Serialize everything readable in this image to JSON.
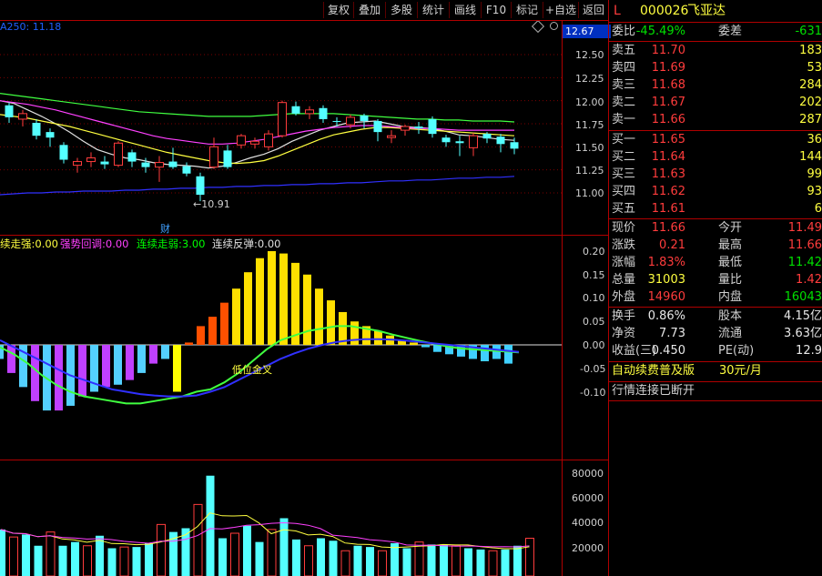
{
  "toolbar": {
    "buttons": [
      "复权",
      "叠加",
      "多股",
      "统计",
      "画线",
      "F10",
      "标记",
      "+自选",
      "返回"
    ]
  },
  "header": {
    "marker": "L",
    "code": "000026",
    "name": "飞亚达"
  },
  "chart_top_label": "A250: 11.18",
  "price_axis": {
    "current": "12.67",
    "ticks": [
      "12.50",
      "12.25",
      "12.00",
      "11.75",
      "11.50",
      "11.25",
      "11.00"
    ],
    "low_annotation": "10.91",
    "finance_mark": "财"
  },
  "indicator_legend": {
    "items": [
      {
        "label": "续走强:",
        "value": "0.00",
        "color": "#ffff40"
      },
      {
        "label": "强势回调:",
        "value": "0.00",
        "color": "#ff40ff"
      },
      {
        "label": "连续走弱:",
        "value": "3.00",
        "color": "#00ff00"
      },
      {
        "label": "连续反弹:",
        "value": "0.00",
        "color": "#e0e0e0"
      }
    ],
    "annotation": "低位金叉"
  },
  "indicator_axis": {
    "ticks": [
      "0.20",
      "0.15",
      "0.10",
      "0.05",
      "0.00",
      "-0.05",
      "-0.10"
    ]
  },
  "volume_axis": {
    "ticks": [
      "80000",
      "60000",
      "40000",
      "20000"
    ]
  },
  "quote": {
    "weibi": {
      "label": "委比",
      "value": "-45.49%",
      "label2": "委差",
      "value2": "-631"
    },
    "asks": [
      {
        "label": "卖五",
        "price": "11.70",
        "vol": "183"
      },
      {
        "label": "卖四",
        "price": "11.69",
        "vol": "53"
      },
      {
        "label": "卖三",
        "price": "11.68",
        "vol": "284"
      },
      {
        "label": "卖二",
        "price": "11.67",
        "vol": "202"
      },
      {
        "label": "卖一",
        "price": "11.66",
        "vol": "287"
      }
    ],
    "bids": [
      {
        "label": "买一",
        "price": "11.65",
        "vol": "36"
      },
      {
        "label": "买二",
        "price": "11.64",
        "vol": "144"
      },
      {
        "label": "买三",
        "price": "11.63",
        "vol": "99"
      },
      {
        "label": "买四",
        "price": "11.62",
        "vol": "93"
      },
      {
        "label": "买五",
        "price": "11.61",
        "vol": "6"
      }
    ],
    "stats1": [
      {
        "l": "现价",
        "v": "11.66",
        "vc": "red",
        "l2": "今开",
        "v2": "11.49",
        "v2c": "red"
      },
      {
        "l": "涨跌",
        "v": "0.21",
        "vc": "red",
        "l2": "最高",
        "v2": "11.66",
        "v2c": "red"
      },
      {
        "l": "涨幅",
        "v": "1.83%",
        "vc": "red",
        "l2": "最低",
        "v2": "11.42",
        "v2c": "green"
      },
      {
        "l": "总量",
        "v": "31003",
        "vc": "yellow",
        "l2": "量比",
        "v2": "1.42",
        "v2c": "red"
      },
      {
        "l": "外盘",
        "v": "14960",
        "vc": "red",
        "l2": "内盘",
        "v2": "16043",
        "v2c": "green"
      }
    ],
    "stats2": [
      {
        "l": "换手",
        "v": "0.86%",
        "l2": "股本",
        "v2": "4.15亿"
      },
      {
        "l": "净资",
        "v": "7.73",
        "l2": "流通",
        "v2": "3.63亿"
      },
      {
        "l": "收益(三)",
        "v": "0.450",
        "l2": "PE(动)",
        "v2": "12.9"
      }
    ],
    "promo": "自动续费普及版",
    "promo_price": "30元/月",
    "status": "行情连接已断开"
  },
  "colors": {
    "up": "#ff3c3c",
    "down": "#54ffff",
    "ma_white": "#e0e0e0",
    "ma_yellow": "#ffff40",
    "ma_magenta": "#ff40ff",
    "ma_green": "#40ff40",
    "ma_blue": "#3030ff"
  },
  "candles": [
    {
      "o": 11.95,
      "c": 11.82,
      "h": 11.98,
      "l": 11.76
    },
    {
      "o": 11.8,
      "c": 11.86,
      "h": 11.9,
      "l": 11.72
    },
    {
      "o": 11.76,
      "c": 11.62,
      "h": 11.8,
      "l": 11.58
    },
    {
      "o": 11.66,
      "c": 11.6,
      "h": 11.7,
      "l": 11.5
    },
    {
      "o": 11.52,
      "c": 11.36,
      "h": 11.55,
      "l": 11.32
    },
    {
      "o": 11.3,
      "c": 11.34,
      "h": 11.38,
      "l": 11.22
    },
    {
      "o": 11.34,
      "c": 11.38,
      "h": 11.44,
      "l": 11.28
    },
    {
      "o": 11.34,
      "c": 11.31,
      "h": 11.4,
      "l": 11.26
    },
    {
      "o": 11.3,
      "c": 11.54,
      "h": 11.56,
      "l": 11.28
    },
    {
      "o": 11.44,
      "c": 11.34,
      "h": 11.47,
      "l": 11.28
    },
    {
      "o": 11.33,
      "c": 11.28,
      "h": 11.38,
      "l": 11.22
    },
    {
      "o": 11.28,
      "c": 11.33,
      "h": 11.4,
      "l": 11.12
    },
    {
      "o": 11.34,
      "c": 11.28,
      "h": 11.49,
      "l": 11.26
    },
    {
      "o": 11.29,
      "c": 11.21,
      "h": 11.33,
      "l": 11.18
    },
    {
      "o": 11.18,
      "c": 10.98,
      "h": 11.22,
      "l": 10.91
    },
    {
      "o": 11.28,
      "c": 11.5,
      "h": 11.6,
      "l": 11.26
    },
    {
      "o": 11.46,
      "c": 11.28,
      "h": 11.52,
      "l": 11.26
    },
    {
      "o": 11.52,
      "c": 11.62,
      "h": 11.64,
      "l": 11.48
    },
    {
      "o": 11.53,
      "c": 11.56,
      "h": 11.6,
      "l": 11.48
    },
    {
      "o": 11.5,
      "c": 11.64,
      "h": 11.68,
      "l": 11.46
    },
    {
      "o": 11.62,
      "c": 11.98,
      "h": 12.0,
      "l": 11.6
    },
    {
      "o": 11.94,
      "c": 11.86,
      "h": 11.99,
      "l": 11.84
    },
    {
      "o": 11.86,
      "c": 11.9,
      "h": 11.94,
      "l": 11.8
    },
    {
      "o": 11.92,
      "c": 11.8,
      "h": 11.95,
      "l": 11.76
    },
    {
      "o": 11.78,
      "c": 11.77,
      "h": 11.82,
      "l": 11.72
    },
    {
      "o": 11.74,
      "c": 11.82,
      "h": 11.85,
      "l": 11.7
    },
    {
      "o": 11.84,
      "c": 11.78,
      "h": 11.86,
      "l": 11.7
    },
    {
      "o": 11.78,
      "c": 11.66,
      "h": 11.8,
      "l": 11.56
    },
    {
      "o": 11.6,
      "c": 11.62,
      "h": 11.68,
      "l": 11.54
    },
    {
      "o": 11.68,
      "c": 11.72,
      "h": 11.74,
      "l": 11.62
    },
    {
      "o": 11.72,
      "c": 11.7,
      "h": 11.77,
      "l": 11.64
    },
    {
      "o": 11.8,
      "c": 11.64,
      "h": 11.83,
      "l": 11.6
    },
    {
      "o": 11.6,
      "c": 11.55,
      "h": 11.63,
      "l": 11.5
    },
    {
      "o": 11.56,
      "c": 11.54,
      "h": 11.62,
      "l": 11.4
    },
    {
      "o": 11.49,
      "c": 11.62,
      "h": 11.65,
      "l": 11.4
    },
    {
      "o": 11.64,
      "c": 11.59,
      "h": 11.66,
      "l": 11.54
    },
    {
      "o": 11.61,
      "c": 11.53,
      "h": 11.64,
      "l": 11.44
    },
    {
      "o": 11.55,
      "c": 11.48,
      "h": 11.6,
      "l": 11.42
    }
  ],
  "ma_lines": {
    "white": [
      12.0,
      11.97,
      11.9,
      11.83,
      11.75,
      11.66,
      11.56,
      11.47,
      11.42,
      11.38,
      11.36,
      11.33,
      11.31,
      11.3,
      11.29,
      11.27,
      11.29,
      11.33,
      11.38,
      11.42,
      11.48,
      11.56,
      11.62,
      11.68,
      11.72,
      11.76,
      11.77,
      11.78,
      11.75,
      11.72,
      11.71,
      11.7,
      11.67,
      11.63,
      11.62,
      11.6,
      11.58,
      11.57
    ],
    "yellow": [
      11.85,
      11.83,
      11.81,
      11.78,
      11.75,
      11.72,
      11.68,
      11.64,
      11.6,
      11.56,
      11.52,
      11.48,
      11.44,
      11.41,
      11.38,
      11.35,
      11.33,
      11.32,
      11.33,
      11.35,
      11.4,
      11.46,
      11.52,
      11.58,
      11.63,
      11.66,
      11.69,
      11.71,
      11.71,
      11.7,
      11.69,
      11.68,
      11.67,
      11.66,
      11.65,
      11.64,
      11.63,
      11.62
    ],
    "magenta": [
      12.0,
      11.98,
      11.96,
      11.93,
      11.9,
      11.86,
      11.82,
      11.78,
      11.74,
      11.7,
      11.66,
      11.62,
      11.59,
      11.57,
      11.55,
      11.53,
      11.53,
      11.54,
      11.56,
      11.58,
      11.61,
      11.64,
      11.67,
      11.69,
      11.71,
      11.72,
      11.73,
      11.73,
      11.72,
      11.71,
      11.7,
      11.7,
      11.69,
      11.68,
      11.68,
      11.68,
      11.68,
      11.68
    ],
    "green": [
      12.08,
      12.06,
      12.04,
      12.02,
      12.0,
      11.98,
      11.96,
      11.94,
      11.92,
      11.9,
      11.88,
      11.87,
      11.86,
      11.85,
      11.84,
      11.83,
      11.83,
      11.83,
      11.83,
      11.84,
      11.85,
      11.86,
      11.86,
      11.86,
      11.86,
      11.85,
      11.84,
      11.83,
      11.82,
      11.81,
      11.8,
      11.8,
      11.79,
      11.79,
      11.78,
      11.78,
      11.78,
      11.77
    ],
    "blue": [
      10.98,
      10.99,
      11.0,
      11.0,
      11.01,
      11.01,
      11.02,
      11.02,
      11.02,
      11.03,
      11.03,
      11.04,
      11.04,
      11.05,
      11.05,
      11.06,
      11.06,
      11.07,
      11.07,
      11.08,
      11.08,
      11.09,
      11.09,
      11.1,
      11.1,
      11.11,
      11.11,
      11.12,
      11.13,
      11.13,
      11.14,
      11.14,
      11.15,
      11.16,
      11.16,
      11.17,
      11.17,
      11.18
    ]
  },
  "macd_bars": [
    -0.03,
    -0.06,
    -0.09,
    -0.12,
    -0.14,
    -0.14,
    -0.13,
    -0.11,
    -0.1,
    -0.09,
    -0.085,
    -0.075,
    -0.06,
    -0.04,
    -0.03,
    -0.1,
    0.005,
    0.04,
    0.06,
    0.09,
    0.12,
    0.155,
    0.185,
    0.2,
    0.195,
    0.175,
    0.15,
    0.12,
    0.095,
    0.07,
    0.05,
    0.04,
    0.03,
    0.02,
    0.01,
    0.005,
    -0.005,
    -0.015,
    -0.02,
    -0.025,
    -0.03,
    -0.035,
    -0.03,
    -0.04
  ],
  "volume": [
    35000,
    29000,
    31000,
    22000,
    33000,
    22000,
    25000,
    22000,
    30000,
    20000,
    21000,
    21000,
    24000,
    39000,
    33000,
    36000,
    55000,
    78000,
    28000,
    32000,
    38000,
    25000,
    35000,
    44000,
    27000,
    22000,
    28000,
    26000,
    18000,
    22000,
    21000,
    18000,
    24000,
    20000,
    25000,
    23000,
    23000,
    22000,
    20000,
    19000,
    18000,
    19000,
    22000,
    28000
  ]
}
